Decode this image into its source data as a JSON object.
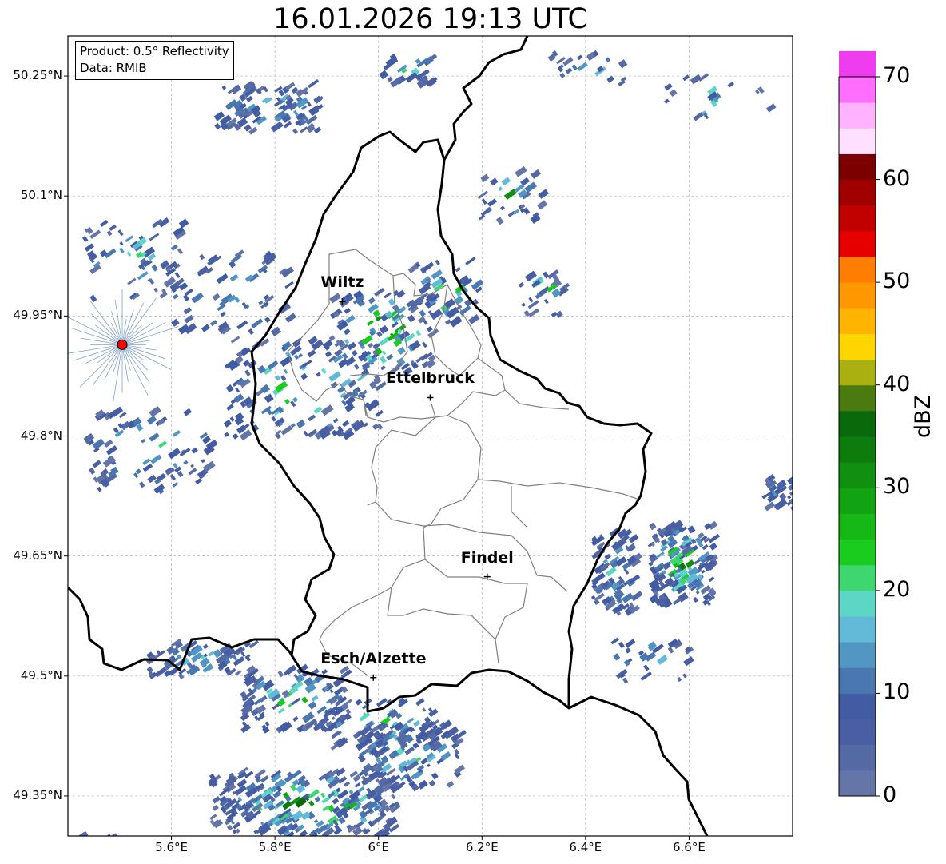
{
  "title": "16.01.2026 19:13 UTC",
  "info": {
    "product": "Product: 0.5° Reflectivity",
    "data": "Data: RMIB"
  },
  "axes": {
    "lat_ticks": [
      "50.25°N",
      "50.1°N",
      "49.95°N",
      "49.8°N",
      "49.65°N",
      "49.5°N",
      "49.35°N"
    ],
    "lon_ticks": [
      "5.6°E",
      "5.8°E",
      "6°E",
      "6.2°E",
      "6.4°E",
      "6.6°E"
    ],
    "lat_range": [
      49.3,
      50.3
    ],
    "lon_range": [
      5.4,
      6.8
    ]
  },
  "cities": [
    {
      "name": "Wiltz",
      "lon": 5.93,
      "lat": 49.968
    },
    {
      "name": "Ettelbruck",
      "lon": 6.1,
      "lat": 49.848
    },
    {
      "name": "Findel",
      "lon": 6.21,
      "lat": 49.624
    },
    {
      "name": "Esch/Alzette",
      "lon": 5.99,
      "lat": 49.498
    }
  ],
  "radar_site": {
    "lon": 5.505,
    "lat": 49.914,
    "color": "#ff0000"
  },
  "colorbar": {
    "label": "dBZ",
    "ticks": [
      "0",
      "10",
      "20",
      "30",
      "40",
      "50",
      "60",
      "70"
    ],
    "min": 0,
    "max": 70,
    "step": 2.5,
    "colors": [
      "#6575a8",
      "#556aa5",
      "#4a5fa3",
      "#425ca3",
      "#4a77b0",
      "#5296c4",
      "#62b9d8",
      "#5ed6c6",
      "#3ed66e",
      "#19cc1f",
      "#15b815",
      "#12a312",
      "#108f10",
      "#0d7c0d",
      "#0a690a",
      "#4a7a10",
      "#aab010",
      "#ffd500",
      "#ffb400",
      "#ff9800",
      "#ff7d00",
      "#e60000",
      "#c20000",
      "#a00000",
      "#7d0000",
      "#ffe0ff",
      "#ffb3ff",
      "#ff6eff",
      "#ee3cee"
    ]
  },
  "colors": {
    "border": "#000000",
    "district": "#808080",
    "grid": "#b0b0b0"
  }
}
